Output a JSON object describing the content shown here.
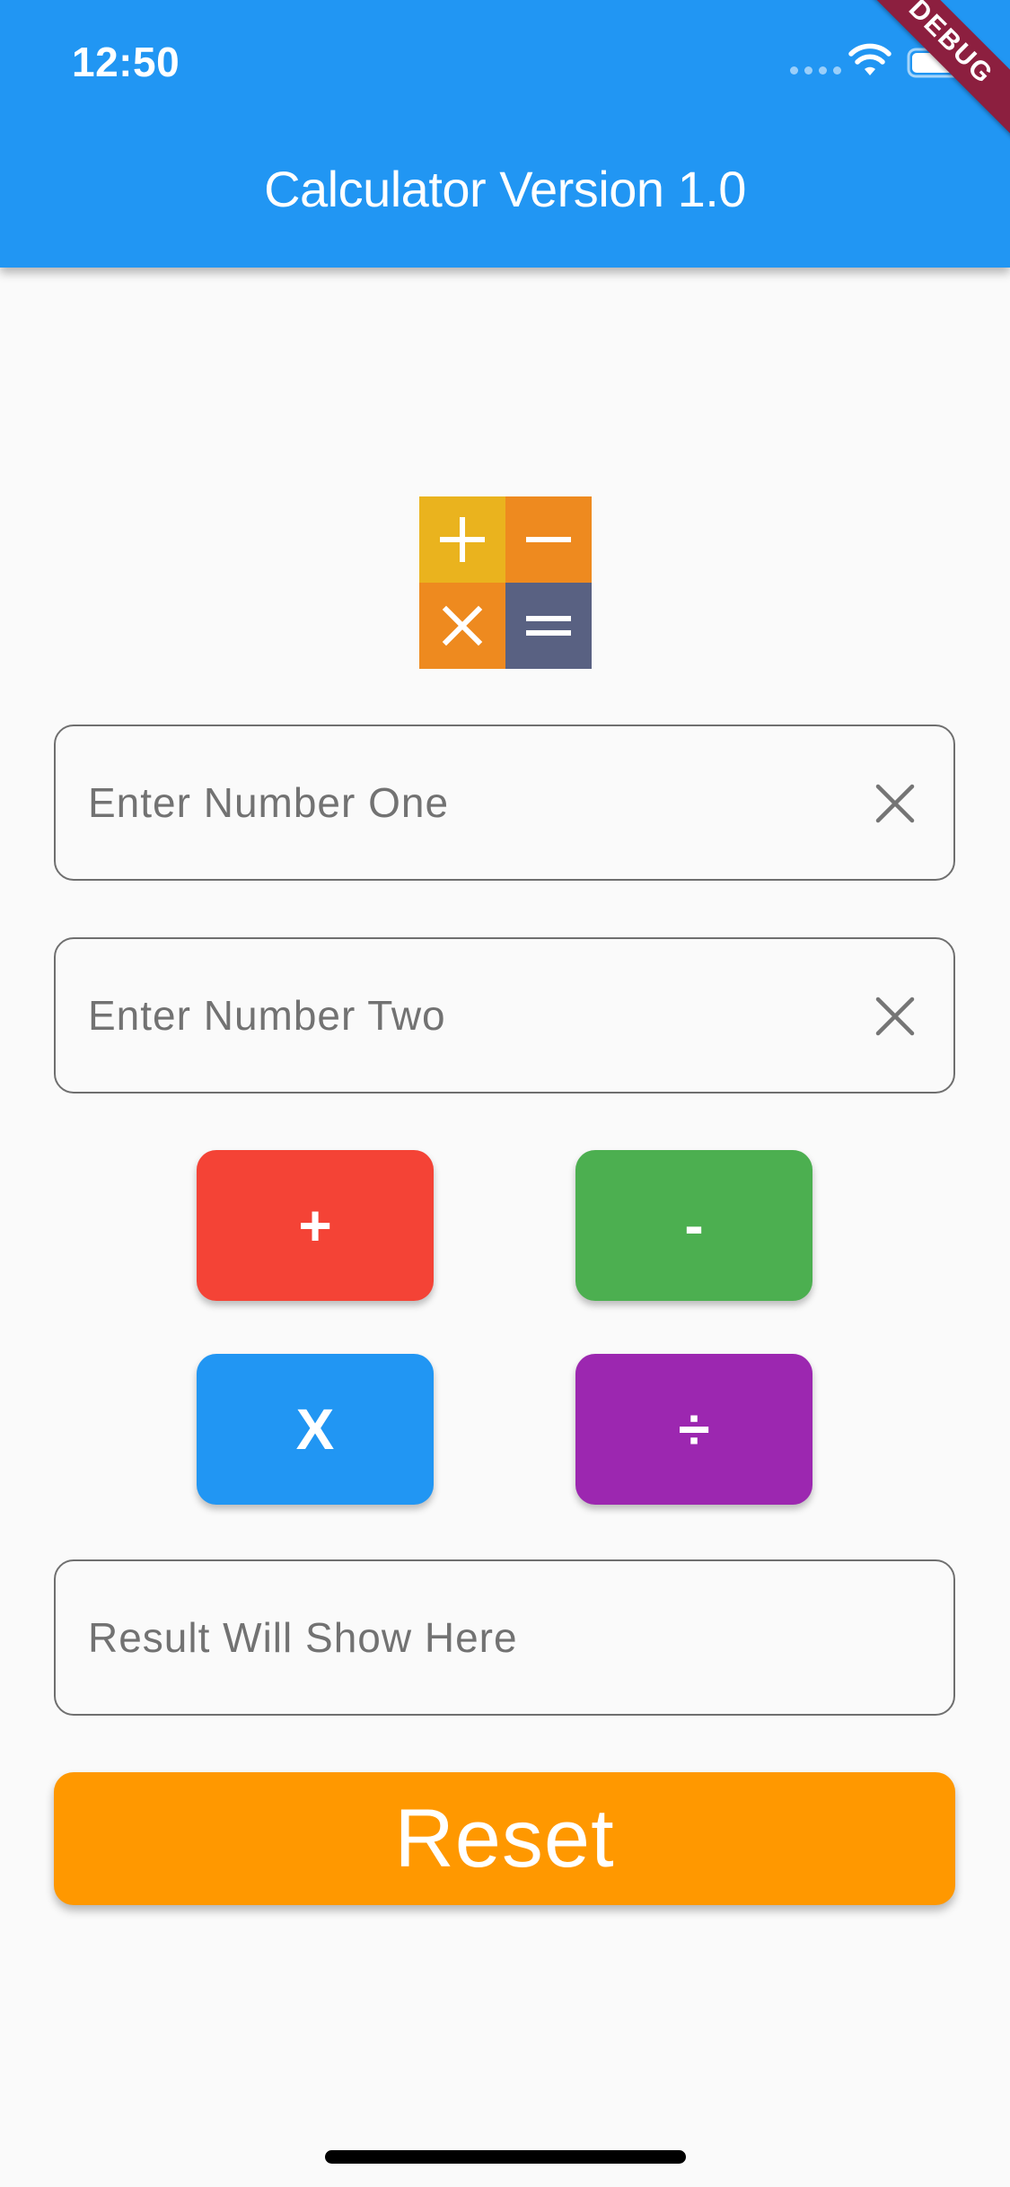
{
  "status_bar": {
    "time": "12:50"
  },
  "app_bar": {
    "title": "Calculator Version 1.0",
    "debug_label": "DEBUG",
    "background_color": "#2196f3"
  },
  "logo": {
    "icons": [
      "plus-icon",
      "minus-icon",
      "multiply-icon",
      "equals-icon"
    ]
  },
  "inputs": {
    "number_one": {
      "value": "",
      "placeholder": "Enter Number One"
    },
    "number_two": {
      "value": "",
      "placeholder": "Enter Number Two"
    },
    "result": {
      "value": "",
      "placeholder": "Result Will Show Here"
    }
  },
  "operations": {
    "add": {
      "label": "+",
      "color": "#f44336"
    },
    "subtract": {
      "label": "-",
      "color": "#4caf50"
    },
    "multiply": {
      "label": "X",
      "color": "#2196f3"
    },
    "divide": {
      "label": "÷",
      "color": "#9c27b0"
    }
  },
  "reset": {
    "label": "Reset",
    "color": "#ff9800"
  }
}
